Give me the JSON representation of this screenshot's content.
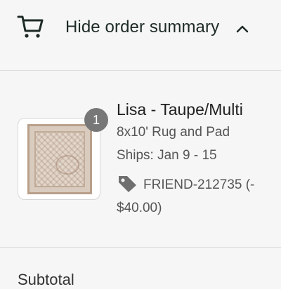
{
  "order_summary": {
    "toggle_label": "Hide order summary",
    "icons": {
      "cart": "cart-icon",
      "chevron": "chevron-up-icon",
      "tag": "tag-icon"
    }
  },
  "line_item": {
    "quantity": "1",
    "name": "Lisa - Taupe/Multi",
    "variant": "8x10' Rug and Pad",
    "shipping": "Ships: Jan 9 - 15",
    "discount_code": "FRIEND-212735 (-",
    "discount_amount": "$40.00)"
  },
  "totals": {
    "subtotal_label": "Subtotal"
  },
  "colors": {
    "background": "#f6f6f6",
    "header_text": "#1d2b24",
    "badge": "#777777",
    "divider": "#dcdcdc"
  }
}
